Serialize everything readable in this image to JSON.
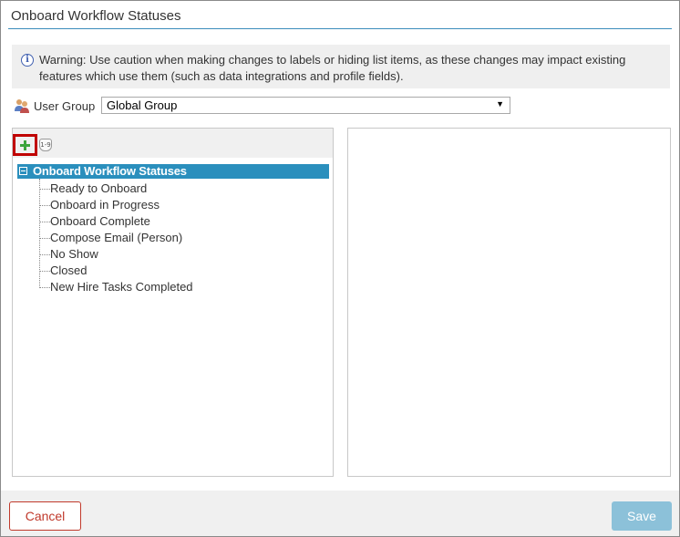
{
  "dialog": {
    "title": "Onboard Workflow Statuses"
  },
  "warning": {
    "icon": "info-icon",
    "line1": "Warning: Use caution when making changes to labels or hiding list items, as these changes may impact existing",
    "line2": "features which use them (such as data integrations and profile fields)."
  },
  "user_group": {
    "icon": "user-group-icon",
    "label": "User Group",
    "selected": "Global Group"
  },
  "toolbar": {
    "add_icon": "plus-icon",
    "sort_icon": "sort-numeric-icon",
    "sort_glyph": "1-9"
  },
  "tree": {
    "root_label": "Onboard Workflow Statuses",
    "items": [
      "Ready to Onboard",
      "Onboard in Progress",
      "Onboard Complete",
      "Compose Email (Person)",
      "No Show",
      "Closed",
      "New Hire Tasks Completed"
    ]
  },
  "footer": {
    "cancel_label": "Cancel",
    "save_label": "Save"
  },
  "colors": {
    "accent": "#2a8fbd",
    "cancel": "#c0392b",
    "save_disabled": "#8cc1d9",
    "highlight_border": "#c00000"
  }
}
